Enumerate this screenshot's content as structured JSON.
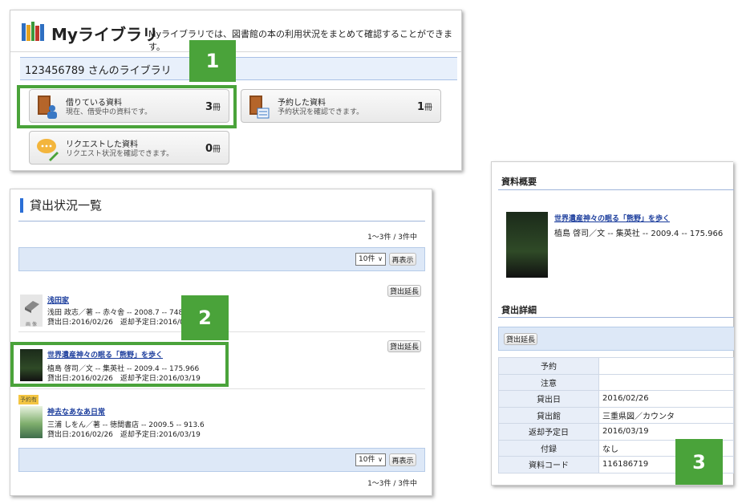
{
  "colors": {
    "accent_green": "#4aa33a",
    "accent_blue": "#2b6fd6",
    "link": "#1a3c9c",
    "bar_blue": "#dde8f7"
  },
  "badges": [
    "1",
    "2",
    "3"
  ],
  "mylibrary": {
    "title": "Myライブラリ",
    "description": "Myライブラリでは、図書館の本の利用状況をまとめて確認することができます。",
    "user_library": "123456789 さんのライブラリ",
    "cards": [
      {
        "title": "借りている資料",
        "desc": "現在、借受中の資料です。",
        "count": "3",
        "unit": "冊",
        "icon": "borrowed-books-icon"
      },
      {
        "title": "予約した資料",
        "desc": "予約状況を確認できます。",
        "count": "1",
        "unit": "冊",
        "icon": "reserved-books-icon"
      },
      {
        "title": "リクエストした資料",
        "desc": "リクエスト状況を確認できます。",
        "count": "0",
        "unit": "冊",
        "icon": "request-speech-icon"
      }
    ]
  },
  "loans": {
    "title": "貸出状況一覧",
    "range": "1～3件 / 3件中",
    "per_page": "10件",
    "redisplay": "再表示",
    "extend": "貸出延長",
    "reserved_tag": "予約有",
    "items": [
      {
        "title": "浅田家",
        "meta": "浅田 政志／著 -- 赤々舎 -- 2008.7 -- 748",
        "dates": "貸出日:2016/02/26　返却予定日:2016/03/19",
        "thumb_label": "画 像"
      },
      {
        "title": "世界遺産神々の眠る「熊野」を歩く",
        "meta": "植島 啓司／文 -- 集英社 -- 2009.4 -- 175.966",
        "dates": "貸出日:2016/02/26　返却予定日:2016/03/19"
      },
      {
        "title": "神去なあなあ日常",
        "meta": "三浦 しをん／著 -- 徳間書店 -- 2009.5 -- 913.6",
        "dates": "貸出日:2016/02/26　返却予定日:2016/03/19"
      }
    ]
  },
  "detail": {
    "summary_heading": "資料概要",
    "book_title": "世界遺産神々の眠る「熊野」を歩く",
    "book_meta": "植島 啓司／文 -- 集英社 -- 2009.4 -- 175.966",
    "loan_heading": "貸出詳細",
    "extend": "貸出延長",
    "rows": [
      {
        "k": "予約",
        "v": ""
      },
      {
        "k": "注意",
        "v": ""
      },
      {
        "k": "貸出日",
        "v": "2016/02/26"
      },
      {
        "k": "貸出館",
        "v": "三重県図／カウンタ"
      },
      {
        "k": "返却予定日",
        "v": "2016/03/19"
      },
      {
        "k": "付録",
        "v": "なし"
      },
      {
        "k": "資料コード",
        "v": "116186719"
      }
    ]
  }
}
